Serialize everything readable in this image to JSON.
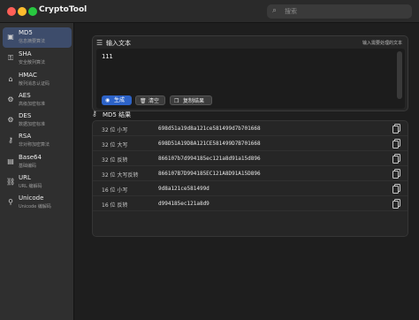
{
  "app": {
    "title": "CryptoTool"
  },
  "search": {
    "placeholder": "搜索"
  },
  "sidebar": {
    "items": [
      {
        "title": "MD5",
        "subtitle": "信息摘要算法",
        "icon": "md5-icon",
        "glyph": "▣",
        "active": true
      },
      {
        "title": "SHA",
        "subtitle": "安全散列算法",
        "icon": "sha-icon",
        "glyph": "⚿"
      },
      {
        "title": "HMAC",
        "subtitle": "散列消息认证码",
        "icon": "hmac-icon",
        "glyph": "⌂"
      },
      {
        "title": "AES",
        "subtitle": "高级加密标准",
        "icon": "aes-icon",
        "glyph": "⚙"
      },
      {
        "title": "DES",
        "subtitle": "数据加密标准",
        "icon": "des-icon",
        "glyph": "⚙"
      },
      {
        "title": "RSA",
        "subtitle": "非对称加密算法",
        "icon": "rsa-icon",
        "glyph": "⚷"
      },
      {
        "title": "Base64",
        "subtitle": "基础编码",
        "icon": "base64-icon",
        "glyph": "▤"
      },
      {
        "title": "URL",
        "subtitle": "URL 编解码",
        "icon": "url-icon",
        "glyph": "⛓"
      },
      {
        "title": "Unicode",
        "subtitle": "Unicode 编解码",
        "icon": "unicode-icon",
        "glyph": "⚲"
      }
    ]
  },
  "input": {
    "title": "输入文本",
    "hint": "输入需要处理的文本",
    "value": "111"
  },
  "buttons": {
    "generate": "生成",
    "clear": "清空",
    "copy_result": "复制结果"
  },
  "results": {
    "title": "MD5 结果",
    "rows": [
      {
        "label": "32 位 小写",
        "value": "698d51a19d8a121ce581499d7b701668"
      },
      {
        "label": "32 位 大写",
        "value": "698D51A19D8A121CE581499D7B701668"
      },
      {
        "label": "32 位 反转",
        "value": "866107b7d994185ec121a8d91a15d896"
      },
      {
        "label": "32 位 大写反转",
        "value": "866107B7D994185EC121A8D91A15D896"
      },
      {
        "label": "16 位 小写",
        "value": "9d8a121ce581499d"
      },
      {
        "label": "16 位 反转",
        "value": "d994185ec121a8d9"
      }
    ]
  },
  "colors": {
    "accent": "#2d63c8",
    "sidebar_active": "#3d4c6b",
    "window_bg": "#1e1e1e"
  }
}
